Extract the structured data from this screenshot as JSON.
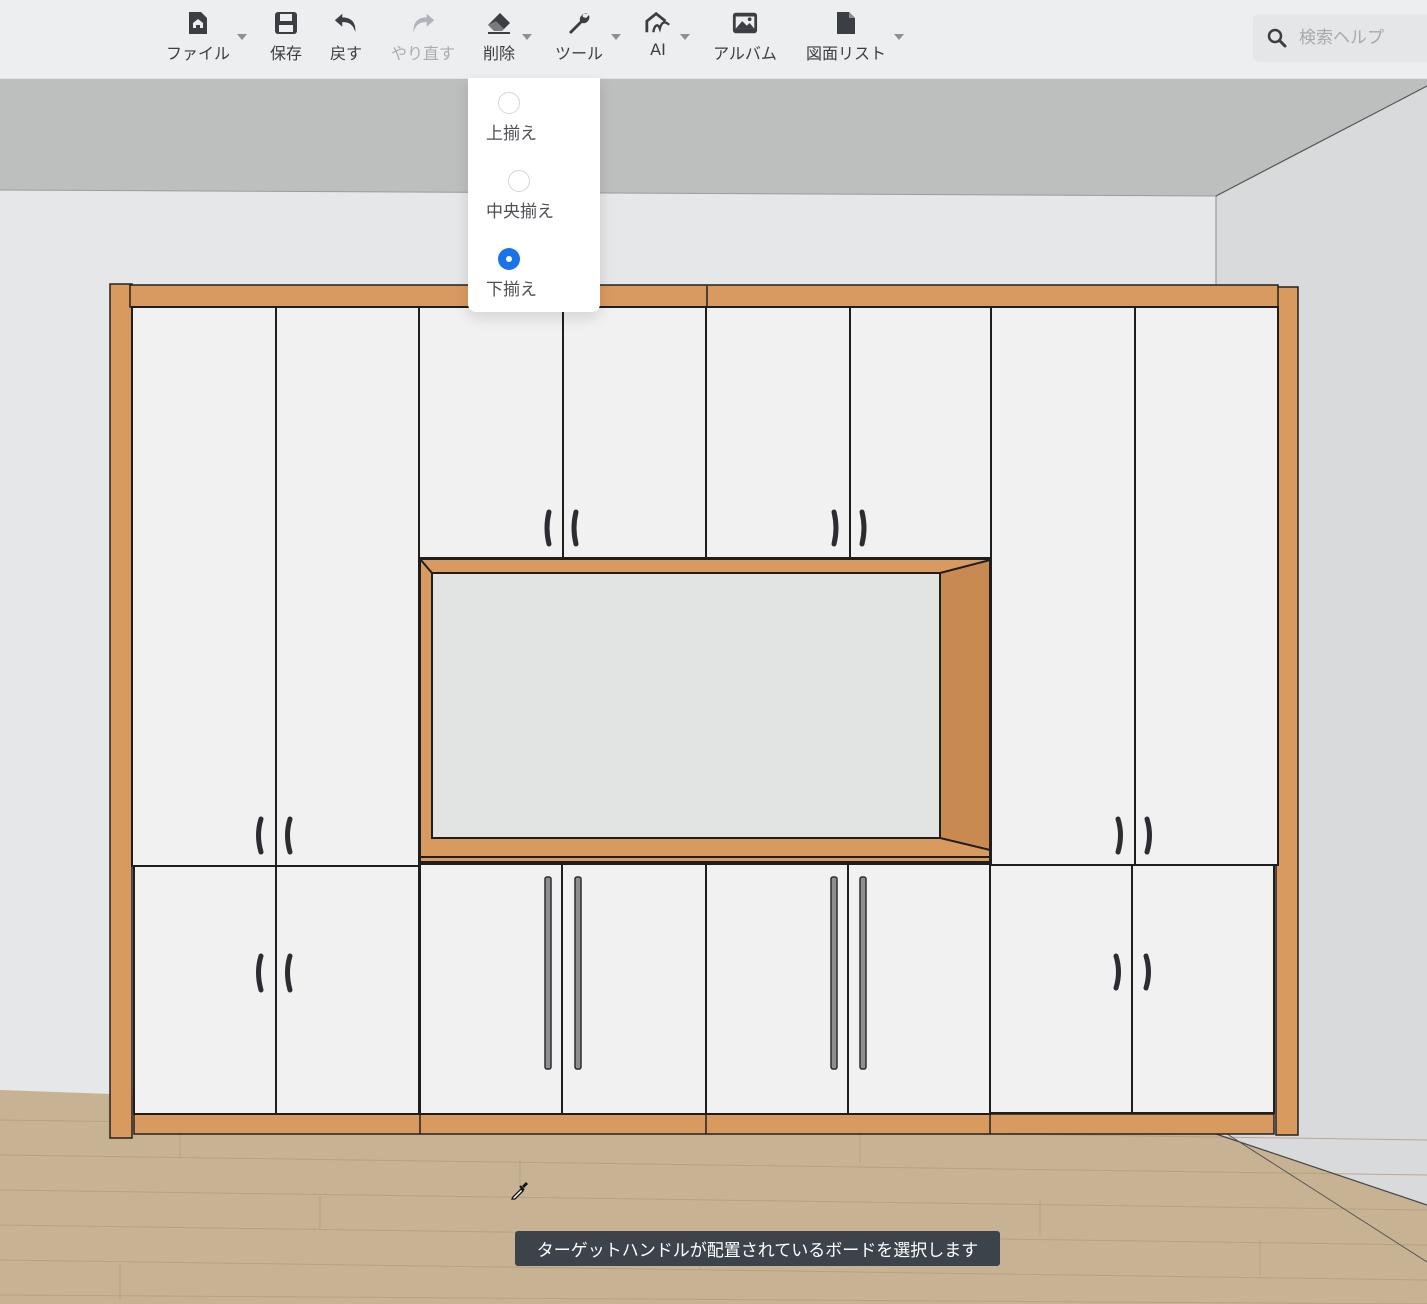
{
  "toolbar": {
    "file_label": "ファイル",
    "save_label": "保存",
    "undo_label": "戻す",
    "redo_label": "やり直す",
    "delete_label": "削除",
    "tools_label": "ツール",
    "ai_label": "AI",
    "album_label": "アルバム",
    "drawing_list_label": "図面リスト"
  },
  "search": {
    "placeholder": "検索ヘルプ"
  },
  "align_menu": {
    "options": [
      {
        "label": "上揃え",
        "selected": false
      },
      {
        "label": "中央揃え",
        "selected": false
      },
      {
        "label": "下揃え",
        "selected": true
      }
    ]
  },
  "tooltip": {
    "text": "ターゲットハンドルが配置されているボードを選択します"
  },
  "colors": {
    "accent": "#1a73e8",
    "toolbar_bg": "#eceeef",
    "wood": "#d99a5f",
    "door": "#f1f1f2",
    "floor": "#c8b294"
  }
}
